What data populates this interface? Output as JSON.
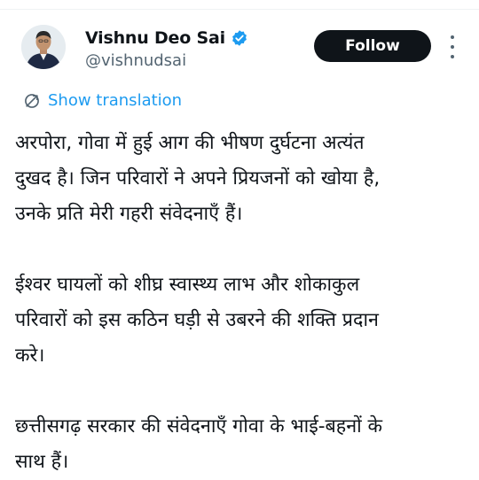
{
  "author": {
    "display_name": "Vishnu Deo Sai",
    "handle": "@vishnudsai",
    "verified_icon": "verified-badge-icon",
    "avatar_icon": "profile-photo"
  },
  "actions": {
    "follow_label": "Follow",
    "more_icon": "more-vertical-icon"
  },
  "translation": {
    "icon": "translate-icon",
    "label": "Show translation"
  },
  "colors": {
    "accent": "#1d9bf0",
    "text": "#0f1419",
    "secondary": "#536471",
    "button_bg": "#0f1419"
  },
  "tweet": {
    "paragraphs": [
      [
        "अरपोरा, गोवा में हुई आग की भीषण दुर्घटना अत्यंत",
        "दुखद है। जिन परिवारों ने अपने प्रियजनों को खोया है,",
        "उनके प्रति मेरी गहरी संवेदनाएँ हैं।"
      ],
      [
        "ईश्वर घायलों को शीघ्र स्वास्थ्य लाभ और शोकाकुल",
        "परिवारों को इस कठिन घड़ी से उबरने की शक्ति प्रदान",
        "करे।"
      ],
      [
        "छत्तीसगढ़ सरकार की संवेदनाएँ गोवा के भाई-बहनों के",
        "साथ हैं।"
      ]
    ]
  }
}
